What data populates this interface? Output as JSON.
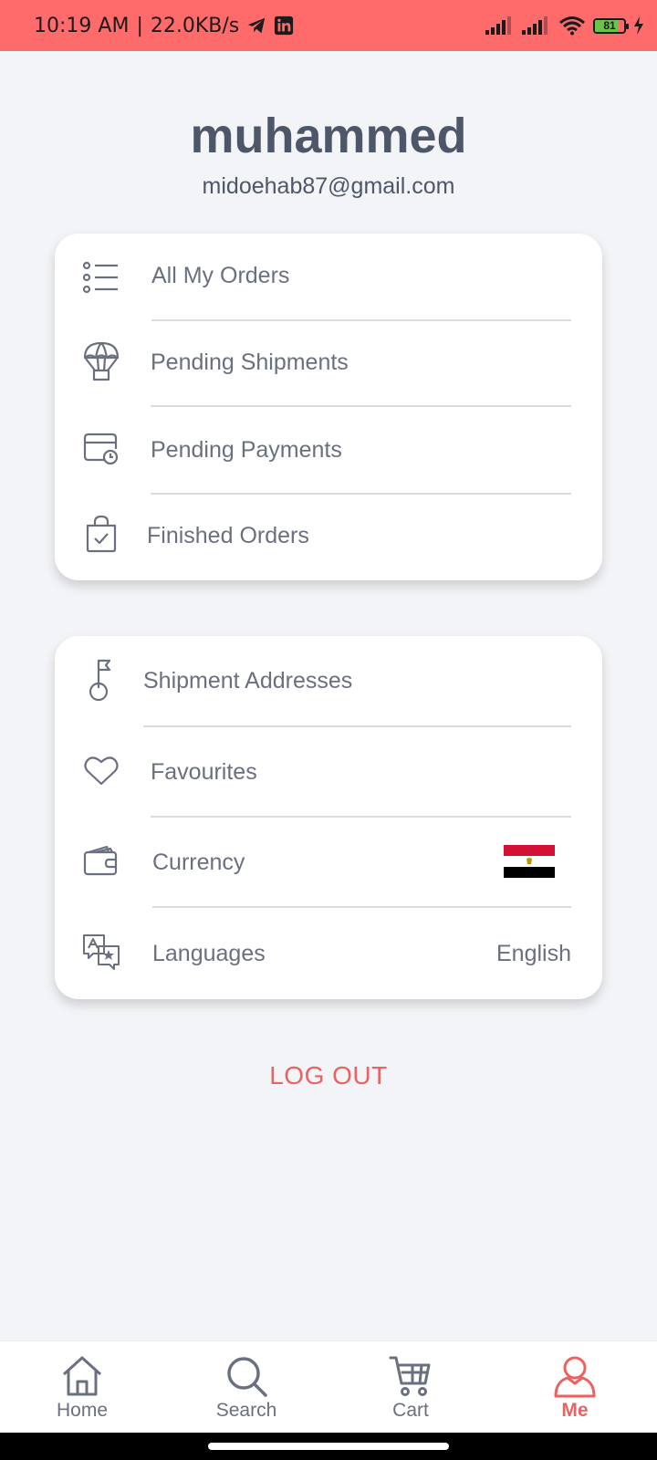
{
  "status_bar": {
    "time": "10:19 AM",
    "separator": "|",
    "speed": "22.0KB/s",
    "battery": "81",
    "battery_level": 0.81,
    "background_color": "#ff6b6b"
  },
  "profile": {
    "name": "muhammed",
    "email": "midoehab87@gmail.com"
  },
  "orders_card": {
    "items": [
      {
        "label": "All My Orders",
        "icon": "list-icon"
      },
      {
        "label": "Pending Shipments",
        "icon": "parachute-icon"
      },
      {
        "label": "Pending Payments",
        "icon": "card-clock-icon"
      },
      {
        "label": "Finished Orders",
        "icon": "bag-check-icon"
      }
    ]
  },
  "settings_card": {
    "items": [
      {
        "label": "Shipment Addresses",
        "icon": "flag-pin-icon"
      },
      {
        "label": "Favourites",
        "icon": "heart-icon"
      },
      {
        "label": "Currency",
        "icon": "wallet-icon",
        "value_icon": "egypt-flag-icon"
      },
      {
        "label": "Languages",
        "icon": "translate-icon",
        "value": "English"
      }
    ]
  },
  "logout_label": "LOG OUT",
  "bottom_nav": {
    "items": [
      {
        "label": "Home",
        "icon": "home-icon"
      },
      {
        "label": "Search",
        "icon": "search-icon"
      },
      {
        "label": "Cart",
        "icon": "cart-icon"
      },
      {
        "label": "Me",
        "icon": "user-icon",
        "active": true
      }
    ]
  },
  "colors": {
    "accent": "#ee6161",
    "text": "#4e5669",
    "muted": "#6a7080",
    "background": "#f3f4f7"
  }
}
